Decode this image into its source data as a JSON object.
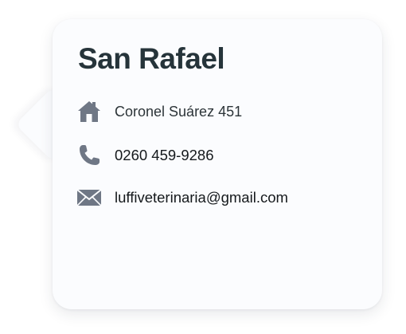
{
  "card": {
    "title": "San Rafael",
    "address": "Coronel Suárez 451",
    "phone": "0260 459-9286",
    "email": "luffiveterinaria@gmail.com"
  },
  "icons": {
    "address": "home-icon",
    "phone": "phone-icon",
    "email": "envelope-icon"
  },
  "colors": {
    "card_background": "#fbfcfe",
    "title": "#26343a",
    "icon": "#6f7785"
  }
}
